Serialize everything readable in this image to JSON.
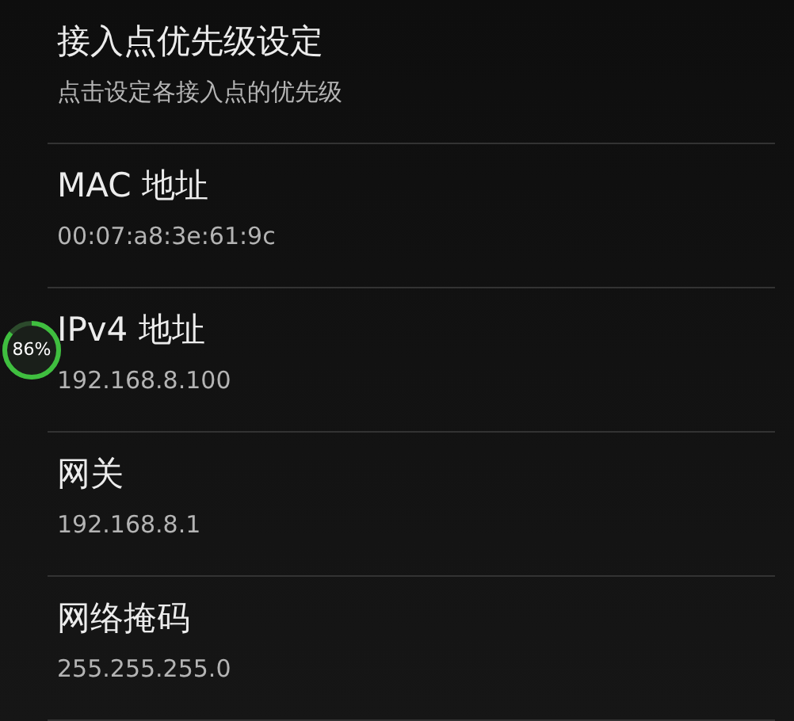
{
  "items": [
    {
      "title": "接入点优先级设定",
      "summary": "点击设定各接入点的优先级"
    },
    {
      "title": "MAC 地址",
      "summary": "00:07:a8:3e:61:9c"
    },
    {
      "title": "IPv4 地址",
      "summary": "192.168.8.100"
    },
    {
      "title": "网关",
      "summary": "192.168.8.1"
    },
    {
      "title": "网络掩码",
      "summary": "255.255.255.0"
    }
  ],
  "floating_badge": {
    "text": "86%",
    "level": 0.86
  }
}
